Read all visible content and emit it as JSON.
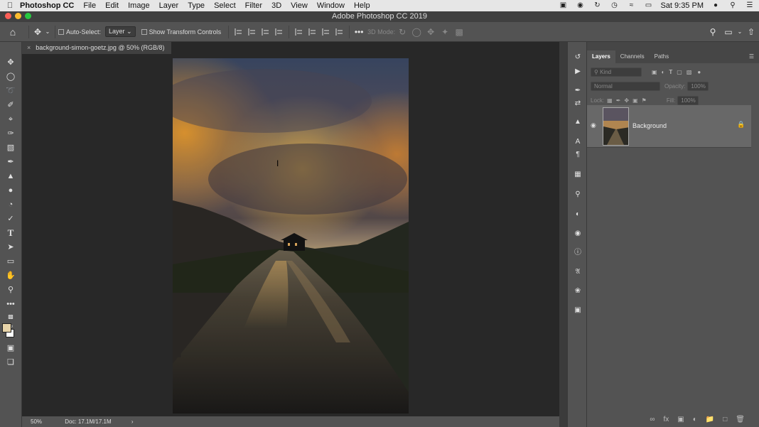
{
  "menubar": {
    "app": "Photoshop CC",
    "items": [
      "File",
      "Edit",
      "Image",
      "Layer",
      "Type",
      "Select",
      "Filter",
      "3D",
      "View",
      "Window",
      "Help"
    ],
    "clock": "Sat 9:35 PM"
  },
  "titlebar": {
    "title": "Adobe Photoshop CC 2019"
  },
  "options": {
    "auto_select_label": "Auto-Select:",
    "auto_select_value": "Layer",
    "show_transform_label": "Show Transform Controls",
    "mode_3d_label": "3D Mode:"
  },
  "document": {
    "tab_title": "background-simon-goetz.jpg @ 50% (RGB/8)",
    "zoom": "50%",
    "doc_size": "Doc: 17.1M/17.1M"
  },
  "layers_panel": {
    "tabs": [
      "Layers",
      "Channels",
      "Paths"
    ],
    "kind_placeholder": "Kind",
    "blend_mode": "Normal",
    "opacity_label": "Opacity:",
    "opacity_value": "100%",
    "lock_label": "Lock:",
    "fill_label": "Fill:",
    "fill_value": "100%",
    "layer_name": "Background"
  },
  "colors": {
    "accent_foreground": "#e6d3a8",
    "background_color": "#ffffff"
  }
}
